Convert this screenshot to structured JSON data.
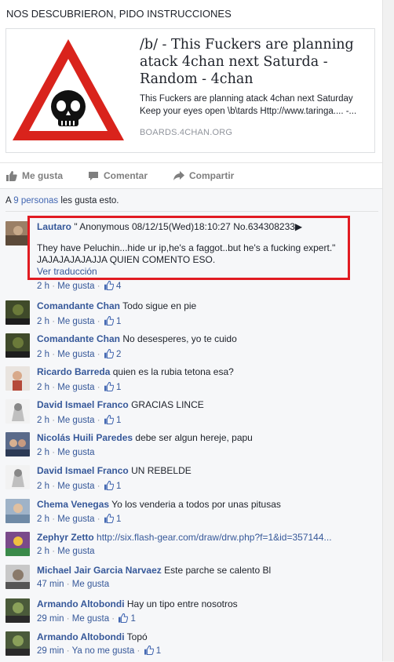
{
  "post": {
    "text": "NOS DESCUBRIERON, PIDO INSTRUCCIONES",
    "link_title": "/b/ - This Fuckers are planning atack 4chan next Saturda - Random - 4chan",
    "link_description_line1": "This Fuckers are planning atack 4chan next Saturday",
    "link_description_line2": "Keep your eyes open \\b\\tards Http://www.taringa.... -...",
    "link_domain": "BOARDS.4CHAN.ORG",
    "thumb_icon": "skull-warning-icon"
  },
  "actions": {
    "like": "Me gusta",
    "comment": "Comentar",
    "share": "Compartir"
  },
  "likes_summary": {
    "prefix": "A ",
    "link": "9 personas",
    "suffix": " les gusta esto."
  },
  "colors": {
    "link_blue": "#365899",
    "highlight_red": "#e11b22",
    "warning_red": "#d9231c"
  },
  "comments": [
    {
      "author": "Lautaro",
      "text_line1": " \" Anonymous 08/12/15(Wed)18:10:27 No.634308233▶",
      "text_line2": "They have Peluchin...hide ur ip,he's a faggot..but he's a fucking expert.\"",
      "text_line3": "JAJAJAJAJAJJA QUIEN COMENTO ESO.",
      "translate": "Ver traducción",
      "time": "2 h",
      "like_label": "Me gusta",
      "likes": "4"
    },
    {
      "author": "Comandante Chan",
      "text": "Todo sigue en pie",
      "time": "2 h",
      "like_label": "Me gusta",
      "likes": "1"
    },
    {
      "author": "Comandante Chan",
      "text": "No desesperes, yo te cuido",
      "time": "2 h",
      "like_label": "Me gusta",
      "likes": "2"
    },
    {
      "author": "Ricardo Barreda",
      "text": "quien es la rubia tetona esa?",
      "time": "2 h",
      "like_label": "Me gusta",
      "likes": "1"
    },
    {
      "author": "David Ismael Franco",
      "text": "GRACIAS LINCE",
      "time": "2 h",
      "like_label": "Me gusta",
      "likes": "1"
    },
    {
      "author": "Nicolás Huili Paredes",
      "text": "debe ser algun hereje, papu",
      "time": "2 h",
      "like_label": "Me gusta",
      "likes": ""
    },
    {
      "author": "David Ismael Franco",
      "text": "UN REBELDE",
      "time": "2 h",
      "like_label": "Me gusta",
      "likes": "1"
    },
    {
      "author": "Chema Venegas",
      "text": "Yo los venderia a todos por unas pitusas",
      "time": "2 h",
      "like_label": "Me gusta",
      "likes": "1"
    },
    {
      "author": "Zephyr Zetto",
      "text": "http://six.flash-gear.com/draw/drw.php?f=1&id=357144...",
      "time": "2 h",
      "like_label": "Me gusta",
      "likes": ""
    },
    {
      "author": "Michael Jair Garcia Narvaez",
      "text": "Este parche se calento Bl",
      "time": "47 min",
      "like_label": "Me gusta",
      "likes": ""
    },
    {
      "author": "Armando Altobondi",
      "text": "Hay un tipo entre nosotros",
      "time": "29 min",
      "like_label": "Me gusta",
      "likes": "1"
    },
    {
      "author": "Armando Altobondi",
      "text": "Topó",
      "time": "29 min",
      "like_label": "Ya no me gusta",
      "likes": "1"
    }
  ]
}
